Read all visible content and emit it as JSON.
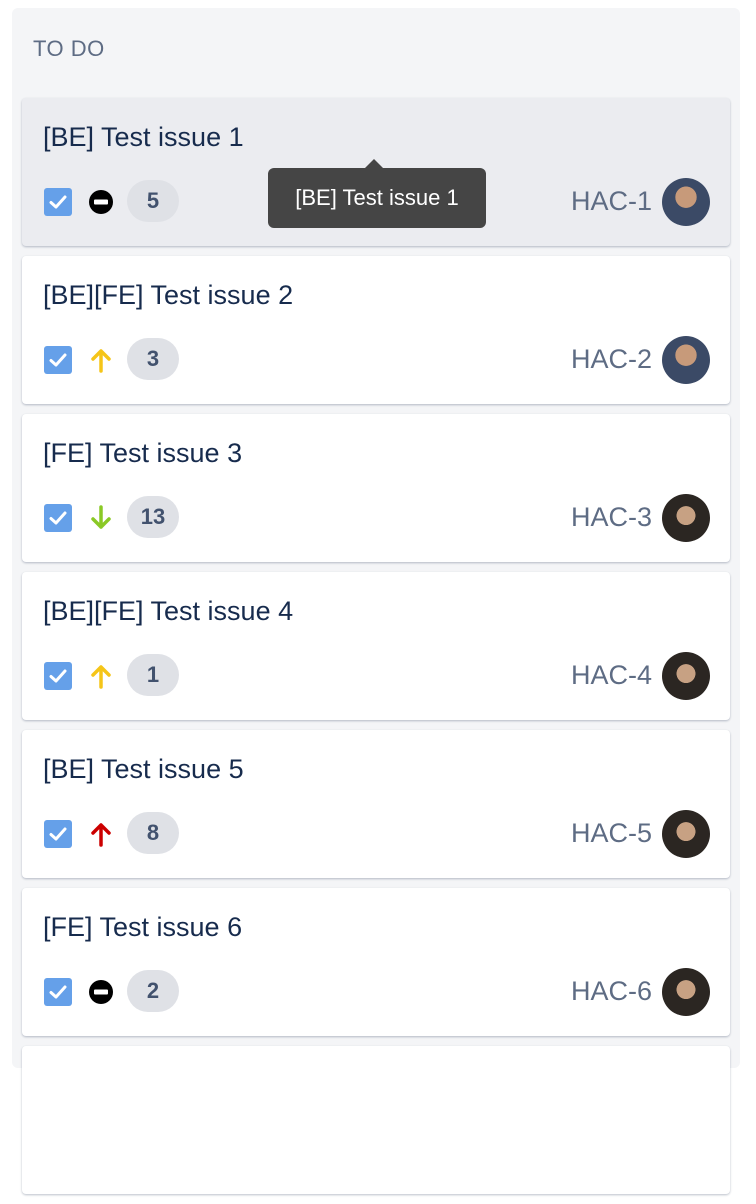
{
  "column": {
    "title": "TO DO"
  },
  "tooltip": {
    "text": "[BE] Test issue 1"
  },
  "colors": {
    "issue_type": "#65a0e9",
    "priority_blocker": "#000000",
    "priority_medium": "#f5c518",
    "priority_low": "#8ac926",
    "priority_high": "#cc0000"
  },
  "cards": [
    {
      "title": "[BE] Test issue 1",
      "key": "HAC-1",
      "estimate": "5",
      "priority_icon": "blocker-icon",
      "avatar": "avatar-user-1"
    },
    {
      "title": "[BE][FE] Test issue 2",
      "key": "HAC-2",
      "estimate": "3",
      "priority_icon": "arrow-up-medium-icon",
      "avatar": "avatar-user-1"
    },
    {
      "title": "[FE] Test issue 3",
      "key": "HAC-3",
      "estimate": "13",
      "priority_icon": "arrow-down-low-icon",
      "avatar": "avatar-user-2"
    },
    {
      "title": "[BE][FE] Test issue 4",
      "key": "HAC-4",
      "estimate": "1",
      "priority_icon": "arrow-up-medium-icon",
      "avatar": "avatar-user-2"
    },
    {
      "title": "[BE] Test issue 5",
      "key": "HAC-5",
      "estimate": "8",
      "priority_icon": "arrow-up-high-icon",
      "avatar": "avatar-user-2"
    },
    {
      "title": "[FE] Test issue 6",
      "key": "HAC-6",
      "estimate": "2",
      "priority_icon": "blocker-icon",
      "avatar": "avatar-user-2"
    }
  ]
}
